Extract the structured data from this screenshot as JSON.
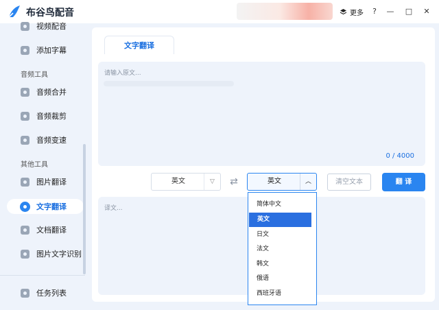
{
  "app": {
    "title": "布谷鸟配音",
    "more_label": "更多"
  },
  "window_controls": {
    "help": "?",
    "minimize": "—",
    "maximize": "□",
    "close": "✕"
  },
  "sidebar": {
    "items": [
      {
        "label": "视频配音",
        "icon": "video-dub-icon"
      },
      {
        "label": "添加字幕",
        "icon": "subtitle-icon"
      },
      {
        "label": "音频合并",
        "icon": "audio-merge-icon"
      },
      {
        "label": "音频裁剪",
        "icon": "audio-cut-icon"
      },
      {
        "label": "音频变速",
        "icon": "audio-speed-icon"
      },
      {
        "label": "图片翻译",
        "icon": "image-translate-icon"
      },
      {
        "label": "文字翻译",
        "icon": "text-translate-icon",
        "active": true
      },
      {
        "label": "文档翻译",
        "icon": "doc-translate-icon"
      },
      {
        "label": "图片文字识别",
        "icon": "ocr-icon"
      }
    ],
    "sections": {
      "audio_tools": "音频工具",
      "other_tools": "其他工具"
    },
    "task_list": "任务列表"
  },
  "main": {
    "tab_label": "文字翻译",
    "source_placeholder": "请输入原文...",
    "char_counter": "0 / 4000",
    "source_language": "英文",
    "target_language": "英文",
    "clear_label": "清空文本",
    "translate_label": "翻 译",
    "output_placeholder": "译文..."
  },
  "dropdown": {
    "options": [
      "简体中文",
      "英文",
      "日文",
      "法文",
      "韩文",
      "俄语",
      "西班牙语"
    ],
    "selected": "英文"
  },
  "colors": {
    "accent": "#2a85f0",
    "background": "#eef3fb"
  }
}
